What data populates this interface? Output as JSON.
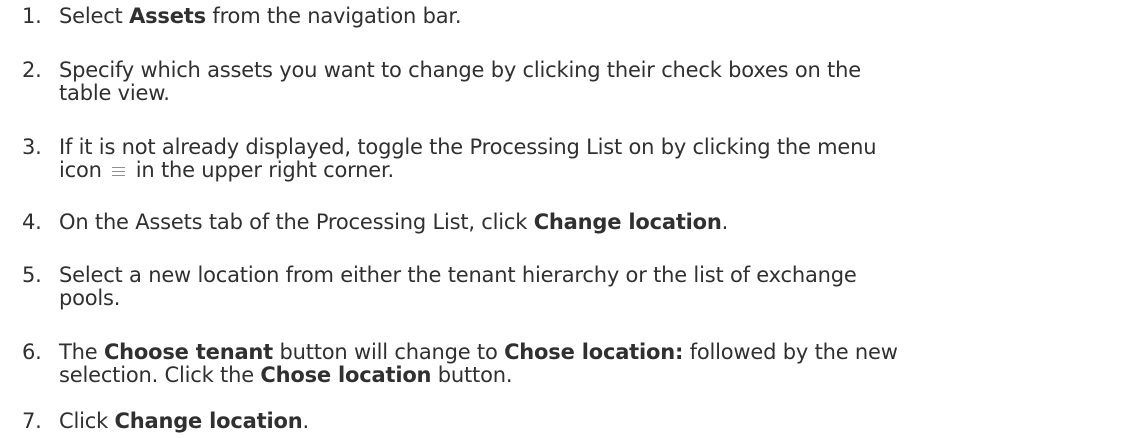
{
  "steps": [
    {
      "number": "1.",
      "pre": "Select ",
      "bold": "Assets",
      "post": " from the navigation bar."
    },
    {
      "number": "2.",
      "line1": "Specify which assets you want to change by clicking their check boxes on the",
      "line2": "table view."
    },
    {
      "number": "3.",
      "line1": "If it is not already displayed, toggle the Processing List on by clicking the menu",
      "pre2": "icon",
      "icon": "menu-icon",
      "post2": "in the upper right corner."
    },
    {
      "number": "4.",
      "pre": "On the Assets tab of the Processing List, click ",
      "bold": "Change location",
      "post": "."
    },
    {
      "number": "5.",
      "line1": "Select a new location from either the tenant hierarchy or the list of exchange",
      "line2": "pools."
    },
    {
      "number": "6.",
      "pre": "The ",
      "bold1": "Choose tenant",
      "mid": " button will change to ",
      "bold2": "Chose location:",
      "post": " followed by the new",
      "line2_pre": "selection. Click the ",
      "line2_bold": "Chose location",
      "line2_post": " button."
    },
    {
      "number": "7.",
      "pre": "Click ",
      "bold": "Change location",
      "post": "."
    }
  ]
}
